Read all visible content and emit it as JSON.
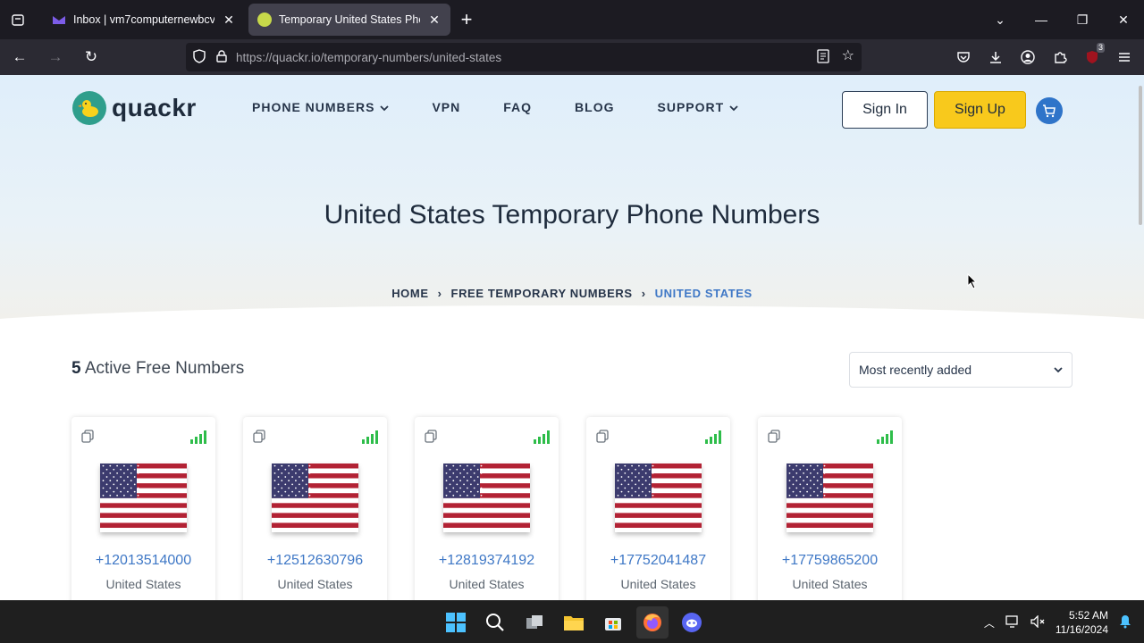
{
  "browser": {
    "tabs": [
      {
        "title": "Inbox | vm7computernewbcvm",
        "active": false,
        "favicon_color": "#7c5ce8"
      },
      {
        "title": "Temporary United States Phone",
        "active": true,
        "favicon_color": "#c7d94a"
      }
    ],
    "url_domain": "https://quackr.io",
    "url_path": "/temporary-numbers/united-states",
    "extension_badge": "3"
  },
  "site": {
    "logo_text": "quackr",
    "nav": [
      {
        "label": "PHONE NUMBERS",
        "dropdown": true
      },
      {
        "label": "VPN",
        "dropdown": false
      },
      {
        "label": "FAQ",
        "dropdown": false
      },
      {
        "label": "BLOG",
        "dropdown": false
      },
      {
        "label": "SUPPORT",
        "dropdown": true
      }
    ],
    "signin_label": "Sign In",
    "signup_label": "Sign Up",
    "page_title": "United States Temporary Phone Numbers",
    "breadcrumb": [
      "HOME",
      "FREE TEMPORARY NUMBERS",
      "UNITED STATES"
    ],
    "count_number": "5",
    "count_label": "Active Free Numbers",
    "sort_selected": "Most recently added",
    "numbers": [
      {
        "number": "+12013514000",
        "country": "United States"
      },
      {
        "number": "+12512630796",
        "country": "United States"
      },
      {
        "number": "+12819374192",
        "country": "United States"
      },
      {
        "number": "+17752041487",
        "country": "United States"
      },
      {
        "number": "+17759865200",
        "country": "United States"
      }
    ]
  },
  "taskbar": {
    "time": "5:52 AM",
    "date": "11/16/2024"
  },
  "colors": {
    "accent_blue": "#3f78c6",
    "signup_yellow": "#f8c91c",
    "signal_green": "#2ebd4a"
  }
}
